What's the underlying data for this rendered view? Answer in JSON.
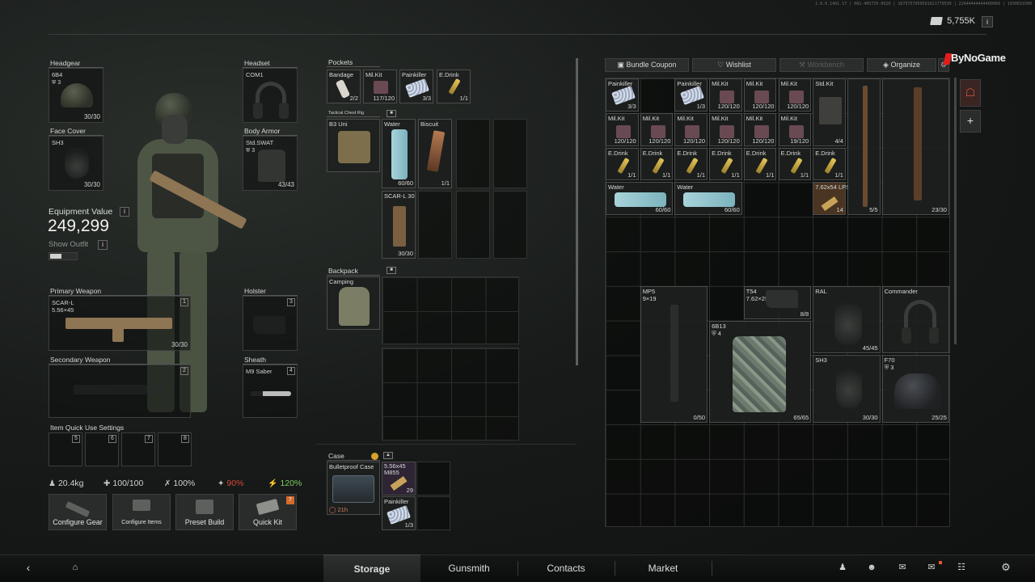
{
  "build_info": "1.0.0.1401.17 | 081-405735-0520 | 1675757959501021779530 | 22444444444400069 | 1930019300",
  "currency": {
    "value": "5,755K",
    "info": "i"
  },
  "slots": {
    "headgear": {
      "label": "Headgear",
      "item": "6B4",
      "armor": "3",
      "durability": "30/30"
    },
    "headset": {
      "label": "Headset",
      "item": "COM1"
    },
    "face_cover": {
      "label": "Face Cover",
      "item": "SH3",
      "durability": "30/30"
    },
    "body_armor": {
      "label": "Body Armor",
      "item": "Std.SWAT",
      "armor": "3",
      "durability": "43/43"
    },
    "primary": {
      "label": "Primary Weapon",
      "item": "SCAR-L",
      "caliber": "5.56×45",
      "durability": "30/30",
      "num": "1"
    },
    "holster": {
      "label": "Holster",
      "num": "3"
    },
    "secondary": {
      "label": "Secondary Weapon",
      "num": "2"
    },
    "sheath": {
      "label": "Sheath",
      "item": "M9 Saber",
      "num": "4"
    }
  },
  "equipment": {
    "label": "Equipment Value",
    "value": "249,299",
    "show_outfit": "Show Outfit",
    "info": "i"
  },
  "quick_use": {
    "label": "Item Quick Use Settings",
    "slots": [
      "5",
      "6",
      "7",
      "8"
    ]
  },
  "stats": {
    "weight": "20.4kg",
    "health": "100/100",
    "stamina": "100%",
    "hydration": "90%",
    "energy": "120%"
  },
  "buttons": {
    "configure_gear": "Configure Gear",
    "configure_items": "Configure Items",
    "preset_build": "Preset Build",
    "quick_kit": "Quick Kit",
    "quick_kit_badge": "7"
  },
  "pockets": {
    "label": "Pockets",
    "items": [
      {
        "name": "Bandage",
        "count": "2/2"
      },
      {
        "name": "Mil.Kit",
        "count": "117/120"
      },
      {
        "name": "Painkiller",
        "count": "3/3"
      },
      {
        "name": "E.Drink",
        "count": "1/1"
      }
    ]
  },
  "rig": {
    "label": "Tactical Chest Rig",
    "item": "B3 Uni",
    "water": {
      "name": "Water",
      "count": "60/60"
    },
    "biscuit": {
      "name": "Biscuit",
      "count": "1/1"
    },
    "mag": {
      "name": "SCAR-L 30",
      "count": "30/30"
    }
  },
  "backpack": {
    "label": "Backpack",
    "item": "Camping"
  },
  "case": {
    "label": "Case",
    "item": "Bulletproof Case",
    "timer": "21h",
    "ammo": {
      "name": "5.56x45 M855",
      "count": "29"
    },
    "painkiller": {
      "name": "Painkiller",
      "count": "1/3"
    }
  },
  "stash_tabs": {
    "bundle": "Bundle Coupon",
    "wishlist": "Wishlist",
    "workbench": "Workbench",
    "organize": "Organize"
  },
  "brand": "ByNoGame",
  "stash": {
    "row1": [
      {
        "name": "Painkiller",
        "count": "3/3"
      },
      {
        "name": "Painkiller",
        "count": "1/3"
      },
      {
        "name": "Mil.Kit",
        "count": "120/120"
      },
      {
        "name": "Mil.Kit",
        "count": "120/120"
      },
      {
        "name": "Mil.Kit",
        "count": "120/120"
      },
      {
        "name": "Std.Kit",
        "count": "4/4"
      }
    ],
    "row2": [
      {
        "name": "Mil.Kit",
        "count": "120/120"
      },
      {
        "name": "Mil.Kit",
        "count": "120/120"
      },
      {
        "name": "Mil.Kit",
        "count": "120/120"
      },
      {
        "name": "Mil.Kit",
        "count": "120/120"
      },
      {
        "name": "Mil.Kit",
        "count": "120/120"
      },
      {
        "name": "Mil.Kit",
        "count": "19/120"
      }
    ],
    "drinks": [
      {
        "name": "E.Drink",
        "count": "1/1"
      },
      {
        "name": "E.Drink",
        "count": "1/1"
      },
      {
        "name": "E.Drink",
        "count": "1/1"
      },
      {
        "name": "E.Drink",
        "count": "1/1"
      },
      {
        "name": "E.Drink",
        "count": "1/1"
      },
      {
        "name": "E.Drink",
        "count": "1/1"
      },
      {
        "name": "E.Drink",
        "count": "1/1"
      }
    ],
    "water": [
      {
        "name": "Water",
        "count": "60/60"
      },
      {
        "name": "Water",
        "count": "60/60"
      }
    ],
    "ammo": {
      "name": "7.62x54 LPS",
      "count": "14"
    },
    "rifle1": {
      "count": "5/5"
    },
    "rifle2": {
      "count": "23/30"
    },
    "mp5": {
      "name": "MP5",
      "caliber": "9×19",
      "count": "0/50"
    },
    "t54": {
      "name": "T54",
      "caliber": "7.62×25",
      "count": "8/8"
    },
    "b13": {
      "name": "6B13",
      "armor": "4",
      "count": "65/65"
    },
    "ral": {
      "name": "RAL",
      "count": "45/45"
    },
    "commander": {
      "name": "Commander"
    },
    "sh3": {
      "name": "SH3",
      "count": "30/30"
    },
    "f70": {
      "name": "F70",
      "armor": "3",
      "count": "25/25"
    }
  },
  "nav": {
    "storage": "Storage",
    "gunsmith": "Gunsmith",
    "contacts": "Contacts",
    "market": "Market"
  }
}
